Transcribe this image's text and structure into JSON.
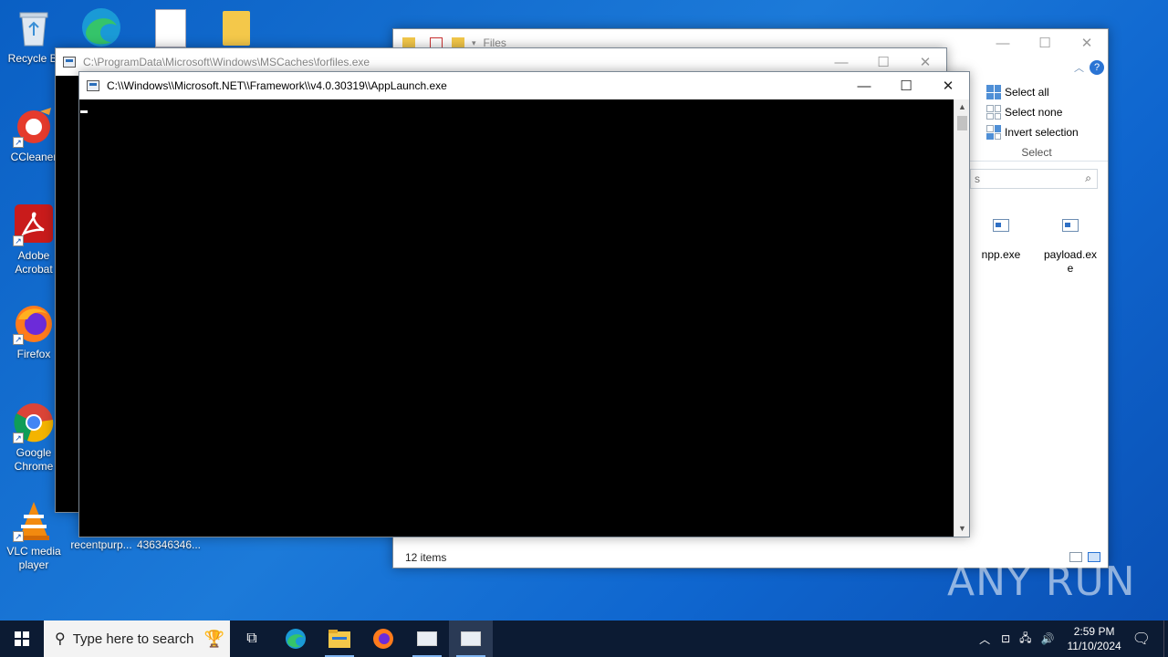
{
  "desktop": {
    "icons": [
      {
        "label": "Recycle Bi"
      },
      {
        "label": "CCleaner"
      },
      {
        "label": "Adobe Acrobat"
      },
      {
        "label": "Firefox"
      },
      {
        "label": "Google Chrome"
      },
      {
        "label": "VLC media player"
      },
      {
        "label": "recentpurp..."
      },
      {
        "label": "436346346..."
      }
    ]
  },
  "explorer": {
    "title": "Files",
    "ribbon": {
      "select_all": "Select all",
      "select_none": "Select none",
      "invert_selection": "Invert selection",
      "group_label": "Select"
    },
    "search_partial": "s",
    "files": [
      {
        "name": "npp.exe"
      },
      {
        "name": "payload.exe"
      }
    ],
    "status": "12 items"
  },
  "forfiles_window": {
    "title": "C:\\ProgramData\\Microsoft\\Windows\\MSCaches\\forfiles.exe"
  },
  "applaunch_window": {
    "title": "C:\\\\Windows\\\\Microsoft.NET\\\\Framework\\\\v4.0.30319\\\\AppLaunch.exe"
  },
  "taskbar": {
    "search_placeholder": "Type here to search",
    "time": "2:59 PM",
    "date": "11/10/2024"
  },
  "watermark": "ANY RUN"
}
